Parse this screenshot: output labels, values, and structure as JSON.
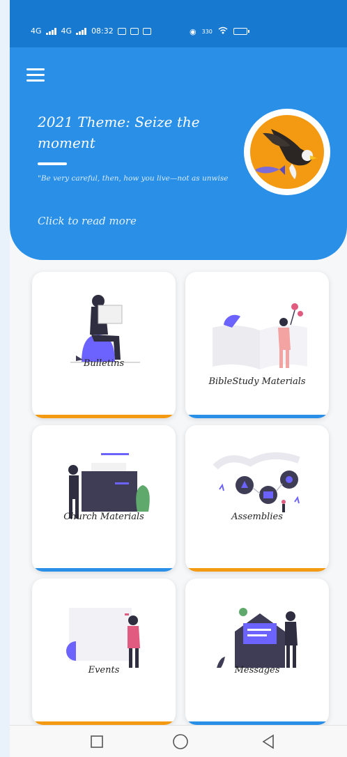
{
  "status_bar": {
    "network_1": "4G",
    "network_2": "4G",
    "time": "08:32",
    "speed": "330"
  },
  "header": {
    "menu_icon": "hamburger-menu-icon",
    "title": "2021 Theme: Seize the moment",
    "verse": "\"Be very careful, then, how you live—not as unwise but as wise, making the most of every",
    "read_more": "Click to read more",
    "image": "eagle-and-fish-icon"
  },
  "cards": [
    {
      "label": "Bulletins",
      "accent": "#f39a12",
      "icon": "reading-person-icon"
    },
    {
      "label": "BibleStudy Materials",
      "accent": "#2a8fe6",
      "icon": "open-bible-icon"
    },
    {
      "label": "Church Materials",
      "accent": "#2a8fe6",
      "icon": "folder-person-icon"
    },
    {
      "label": "Assemblies",
      "accent": "#f39a12",
      "icon": "community-network-icon"
    },
    {
      "label": "Events",
      "accent": "#f39a12",
      "icon": "calendar-person-icon"
    },
    {
      "label": "Messages",
      "accent": "#2a8fe6",
      "icon": "envelope-person-icon"
    }
  ],
  "nav_bar": {
    "recent": "square-recent-apps-icon",
    "home": "circle-home-icon",
    "back": "triangle-back-icon"
  },
  "colors": {
    "primary": "#2a8fe6",
    "status_bar": "#1779cf",
    "accent_orange": "#f39a12"
  }
}
